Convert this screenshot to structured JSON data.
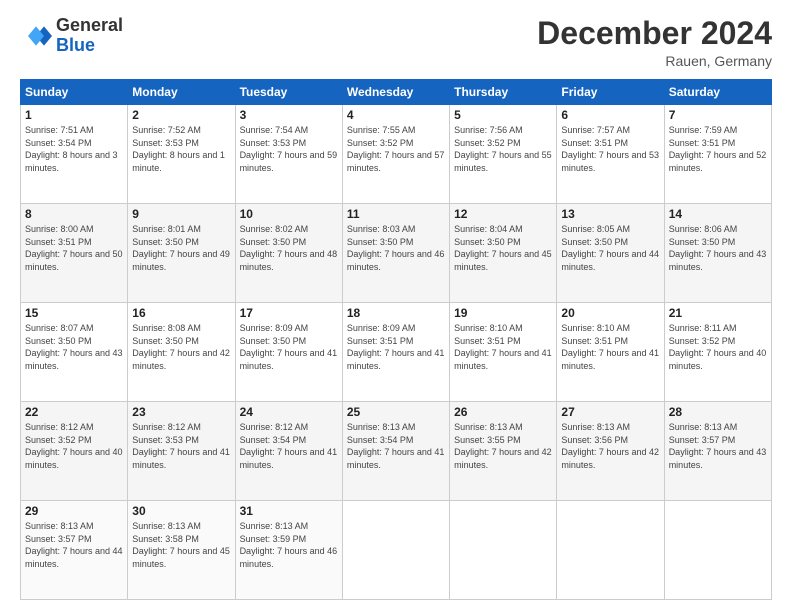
{
  "logo": {
    "general": "General",
    "blue": "Blue"
  },
  "title": "December 2024",
  "location": "Rauen, Germany",
  "days_header": [
    "Sunday",
    "Monday",
    "Tuesday",
    "Wednesday",
    "Thursday",
    "Friday",
    "Saturday"
  ],
  "weeks": [
    [
      {
        "day": "1",
        "sunrise": "Sunrise: 7:51 AM",
        "sunset": "Sunset: 3:54 PM",
        "daylight": "Daylight: 8 hours and 3 minutes."
      },
      {
        "day": "2",
        "sunrise": "Sunrise: 7:52 AM",
        "sunset": "Sunset: 3:53 PM",
        "daylight": "Daylight: 8 hours and 1 minute."
      },
      {
        "day": "3",
        "sunrise": "Sunrise: 7:54 AM",
        "sunset": "Sunset: 3:53 PM",
        "daylight": "Daylight: 7 hours and 59 minutes."
      },
      {
        "day": "4",
        "sunrise": "Sunrise: 7:55 AM",
        "sunset": "Sunset: 3:52 PM",
        "daylight": "Daylight: 7 hours and 57 minutes."
      },
      {
        "day": "5",
        "sunrise": "Sunrise: 7:56 AM",
        "sunset": "Sunset: 3:52 PM",
        "daylight": "Daylight: 7 hours and 55 minutes."
      },
      {
        "day": "6",
        "sunrise": "Sunrise: 7:57 AM",
        "sunset": "Sunset: 3:51 PM",
        "daylight": "Daylight: 7 hours and 53 minutes."
      },
      {
        "day": "7",
        "sunrise": "Sunrise: 7:59 AM",
        "sunset": "Sunset: 3:51 PM",
        "daylight": "Daylight: 7 hours and 52 minutes."
      }
    ],
    [
      {
        "day": "8",
        "sunrise": "Sunrise: 8:00 AM",
        "sunset": "Sunset: 3:51 PM",
        "daylight": "Daylight: 7 hours and 50 minutes."
      },
      {
        "day": "9",
        "sunrise": "Sunrise: 8:01 AM",
        "sunset": "Sunset: 3:50 PM",
        "daylight": "Daylight: 7 hours and 49 minutes."
      },
      {
        "day": "10",
        "sunrise": "Sunrise: 8:02 AM",
        "sunset": "Sunset: 3:50 PM",
        "daylight": "Daylight: 7 hours and 48 minutes."
      },
      {
        "day": "11",
        "sunrise": "Sunrise: 8:03 AM",
        "sunset": "Sunset: 3:50 PM",
        "daylight": "Daylight: 7 hours and 46 minutes."
      },
      {
        "day": "12",
        "sunrise": "Sunrise: 8:04 AM",
        "sunset": "Sunset: 3:50 PM",
        "daylight": "Daylight: 7 hours and 45 minutes."
      },
      {
        "day": "13",
        "sunrise": "Sunrise: 8:05 AM",
        "sunset": "Sunset: 3:50 PM",
        "daylight": "Daylight: 7 hours and 44 minutes."
      },
      {
        "day": "14",
        "sunrise": "Sunrise: 8:06 AM",
        "sunset": "Sunset: 3:50 PM",
        "daylight": "Daylight: 7 hours and 43 minutes."
      }
    ],
    [
      {
        "day": "15",
        "sunrise": "Sunrise: 8:07 AM",
        "sunset": "Sunset: 3:50 PM",
        "daylight": "Daylight: 7 hours and 43 minutes."
      },
      {
        "day": "16",
        "sunrise": "Sunrise: 8:08 AM",
        "sunset": "Sunset: 3:50 PM",
        "daylight": "Daylight: 7 hours and 42 minutes."
      },
      {
        "day": "17",
        "sunrise": "Sunrise: 8:09 AM",
        "sunset": "Sunset: 3:50 PM",
        "daylight": "Daylight: 7 hours and 41 minutes."
      },
      {
        "day": "18",
        "sunrise": "Sunrise: 8:09 AM",
        "sunset": "Sunset: 3:51 PM",
        "daylight": "Daylight: 7 hours and 41 minutes."
      },
      {
        "day": "19",
        "sunrise": "Sunrise: 8:10 AM",
        "sunset": "Sunset: 3:51 PM",
        "daylight": "Daylight: 7 hours and 41 minutes."
      },
      {
        "day": "20",
        "sunrise": "Sunrise: 8:10 AM",
        "sunset": "Sunset: 3:51 PM",
        "daylight": "Daylight: 7 hours and 41 minutes."
      },
      {
        "day": "21",
        "sunrise": "Sunrise: 8:11 AM",
        "sunset": "Sunset: 3:52 PM",
        "daylight": "Daylight: 7 hours and 40 minutes."
      }
    ],
    [
      {
        "day": "22",
        "sunrise": "Sunrise: 8:12 AM",
        "sunset": "Sunset: 3:52 PM",
        "daylight": "Daylight: 7 hours and 40 minutes."
      },
      {
        "day": "23",
        "sunrise": "Sunrise: 8:12 AM",
        "sunset": "Sunset: 3:53 PM",
        "daylight": "Daylight: 7 hours and 41 minutes."
      },
      {
        "day": "24",
        "sunrise": "Sunrise: 8:12 AM",
        "sunset": "Sunset: 3:54 PM",
        "daylight": "Daylight: 7 hours and 41 minutes."
      },
      {
        "day": "25",
        "sunrise": "Sunrise: 8:13 AM",
        "sunset": "Sunset: 3:54 PM",
        "daylight": "Daylight: 7 hours and 41 minutes."
      },
      {
        "day": "26",
        "sunrise": "Sunrise: 8:13 AM",
        "sunset": "Sunset: 3:55 PM",
        "daylight": "Daylight: 7 hours and 42 minutes."
      },
      {
        "day": "27",
        "sunrise": "Sunrise: 8:13 AM",
        "sunset": "Sunset: 3:56 PM",
        "daylight": "Daylight: 7 hours and 42 minutes."
      },
      {
        "day": "28",
        "sunrise": "Sunrise: 8:13 AM",
        "sunset": "Sunset: 3:57 PM",
        "daylight": "Daylight: 7 hours and 43 minutes."
      }
    ],
    [
      {
        "day": "29",
        "sunrise": "Sunrise: 8:13 AM",
        "sunset": "Sunset: 3:57 PM",
        "daylight": "Daylight: 7 hours and 44 minutes."
      },
      {
        "day": "30",
        "sunrise": "Sunrise: 8:13 AM",
        "sunset": "Sunset: 3:58 PM",
        "daylight": "Daylight: 7 hours and 45 minutes."
      },
      {
        "day": "31",
        "sunrise": "Sunrise: 8:13 AM",
        "sunset": "Sunset: 3:59 PM",
        "daylight": "Daylight: 7 hours and 46 minutes."
      },
      null,
      null,
      null,
      null
    ]
  ]
}
